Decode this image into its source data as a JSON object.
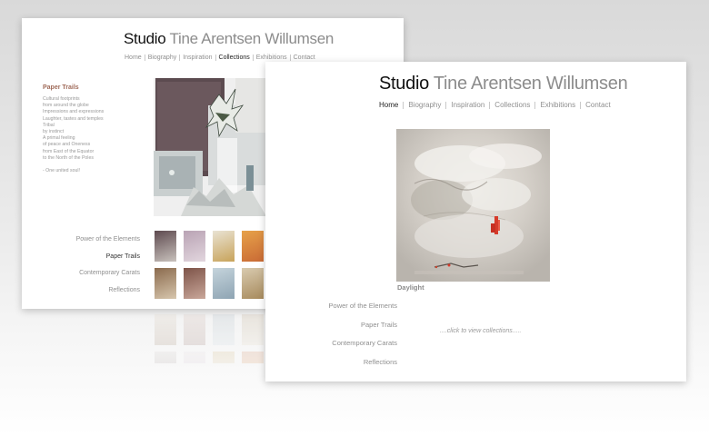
{
  "site": {
    "title_bold": "Studio",
    "title_rest": "Tine Arentsen Willumsen"
  },
  "back_page": {
    "nav": [
      {
        "label": "Home",
        "active": false
      },
      {
        "label": "Biography",
        "active": false
      },
      {
        "label": "Inspiration",
        "active": false
      },
      {
        "label": "Collections",
        "active": true
      },
      {
        "label": "Exhibitions",
        "active": false
      },
      {
        "label": "Contact",
        "active": false
      }
    ],
    "poem_title": "Paper Trails",
    "poem_lines": [
      "Cultural footprints",
      "from around the globe",
      "Impressions and expressions",
      "Laughter, tastes and temples",
      "Tribal",
      "by instinct",
      "A primal feeling",
      "of peace and Oneness",
      "from East of the Equator",
      "to the North of the Poles"
    ],
    "poem_signature": "- One united soul!",
    "categories": [
      {
        "label": "Power of the Elements",
        "active": false
      },
      {
        "label": "Paper Trails",
        "active": true
      },
      {
        "label": "Contemporary Carats",
        "active": false
      },
      {
        "label": "Reflections",
        "active": false
      }
    ],
    "thumbnails": [
      {
        "name": "thumb-1",
        "colors": [
          "#5e4a4f",
          "#c9c2bd"
        ]
      },
      {
        "name": "thumb-2",
        "colors": [
          "#b9a3b4",
          "#e2d6de"
        ]
      },
      {
        "name": "thumb-3",
        "colors": [
          "#e9e3d4",
          "#c8a35a"
        ]
      },
      {
        "name": "thumb-4",
        "colors": [
          "#e7a24a",
          "#c96a35"
        ]
      },
      {
        "name": "thumb-5",
        "colors": [
          "#8a6a4d",
          "#d7c6ad"
        ]
      },
      {
        "name": "thumb-6",
        "colors": [
          "#7d5348",
          "#c9a79a"
        ]
      },
      {
        "name": "thumb-7",
        "colors": [
          "#c5d4dc",
          "#8ea4b3"
        ]
      },
      {
        "name": "thumb-8",
        "colors": [
          "#d9cbb0",
          "#a78a5c"
        ]
      }
    ]
  },
  "front_page": {
    "nav": [
      {
        "label": "Home",
        "active": true
      },
      {
        "label": "Biography",
        "active": false
      },
      {
        "label": "Inspiration",
        "active": false
      },
      {
        "label": "Collections",
        "active": false
      },
      {
        "label": "Exhibitions",
        "active": false
      },
      {
        "label": "Contact",
        "active": false
      }
    ],
    "painting_caption": "Daylight",
    "categories": [
      "Power of the Elements",
      "Paper Trails",
      "Contemporary Carats",
      "Reflections"
    ],
    "hint": "....click to view collections....."
  },
  "colors": {
    "accent_red": "#d63a2a",
    "poem_title": "#a06b5a"
  }
}
